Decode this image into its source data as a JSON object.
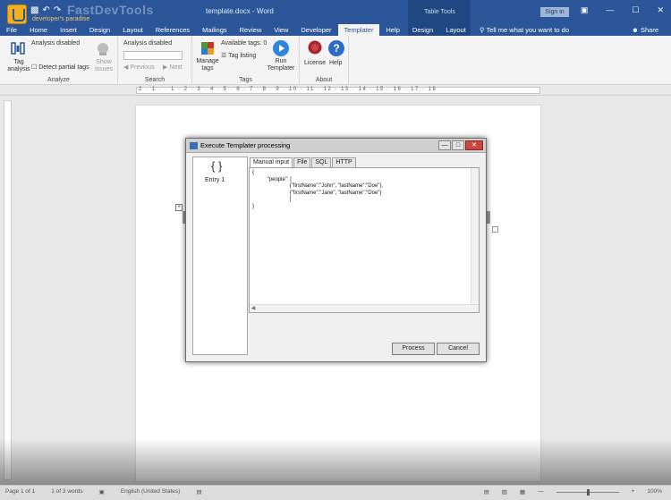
{
  "titlebar": {
    "brand": "FastDevTools",
    "brand_sub": "developer's paradise",
    "doc_title": "template.docx - Word",
    "table_tools": "Table Tools",
    "sign_in": "Sign in",
    "controls": [
      "▣",
      "—",
      "☐",
      "✕"
    ]
  },
  "tabs": [
    "File",
    "Home",
    "Insert",
    "Design",
    "Layout",
    "References",
    "Mailings",
    "Review",
    "View",
    "Developer",
    "Templater",
    "Help",
    "Design",
    "Layout"
  ],
  "active_tab": "Templater",
  "tell_me": "Tell me what you want to do",
  "share": "Share",
  "ribbon": {
    "analyze": {
      "label": "Analyze",
      "tag_analysis": "Tag analysis",
      "status": "Analysis disabled",
      "detect_partial": "Detect partial tags",
      "show_issues": "Show issues"
    },
    "search": {
      "label": "Search",
      "status": "Analysis disabled",
      "previous": "Previous",
      "next": "Next"
    },
    "tags": {
      "label": "Tags",
      "manage": "Manage tags",
      "available": "Available tags: 0",
      "listing": "Tag listing",
      "run": "Run Templater"
    },
    "about": {
      "label": "About",
      "license": "License",
      "help": "Help"
    }
  },
  "ruler_text": "2 · 1 · · 1 · 2 · 3 · 4 · 5 · 6 · 7 · 8 · 9 · 10 · 11 · 12 · 13 · 14 · 15 · 16 · 17 · 18",
  "dialog": {
    "title": "Execute Templater processing",
    "entry_icon": "{ }",
    "entry_label": "Entry 1",
    "tabs": [
      "Manual input",
      "File",
      "SQL",
      "HTTP"
    ],
    "json_text": "{\n          \"people\": [\n                         {\"firstName\":\"John\", \"lastName\":\"Doe\"},\n                         {\"firstName\":\"Jane\", \"lastName\":\"Doe\"}\n                         ]\n}",
    "process": "Process",
    "cancel": "Cancel"
  },
  "status": {
    "page": "Page 1 of 1",
    "words": "1 of 3 words",
    "language": "English (United States)",
    "zoom": "100%"
  },
  "colors": {
    "word_blue": "#2b579a",
    "table_tools_blue": "#1f4883"
  }
}
